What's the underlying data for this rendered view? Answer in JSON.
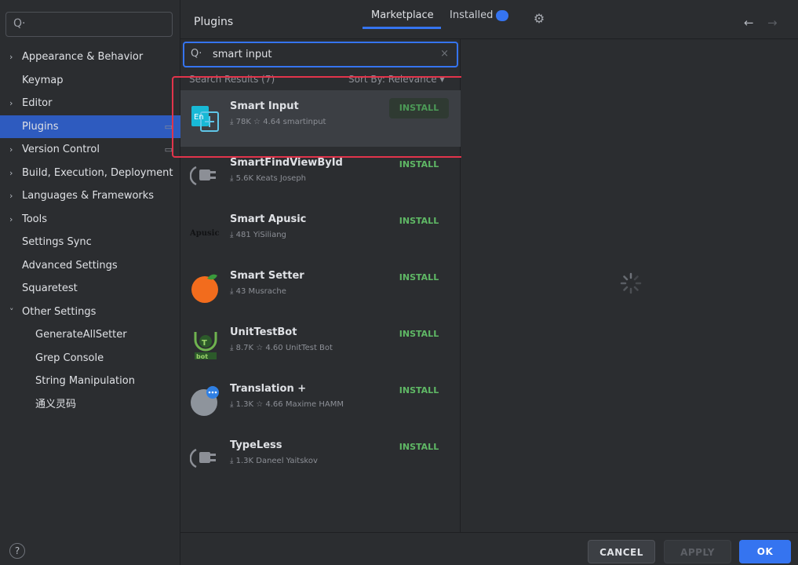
{
  "sidebar": {
    "search_glyph": "Q·",
    "items": [
      {
        "label": "Appearance & Behavior",
        "chevron": "›"
      },
      {
        "label": "Keymap"
      },
      {
        "label": "Editor",
        "chevron": "›"
      },
      {
        "label": "Plugins"
      },
      {
        "label": "Version Control",
        "chevron": "›"
      },
      {
        "label": "Build, Execution, Deployment",
        "chevron": "›"
      },
      {
        "label": "Languages & Frameworks",
        "chevron": "›"
      },
      {
        "label": "Tools",
        "chevron": "›"
      },
      {
        "label": "Settings Sync"
      },
      {
        "label": "Advanced Settings"
      },
      {
        "label": "Squaretest"
      },
      {
        "label": "Other Settings",
        "chevron": "˅"
      },
      {
        "label": "GenerateAllSetter"
      },
      {
        "label": "Grep Console"
      },
      {
        "label": "String Manipulation"
      },
      {
        "label": "通义灵码"
      }
    ],
    "help": "?"
  },
  "header": {
    "title": "Plugins",
    "tabs": {
      "marketplace": "Marketplace",
      "installed": "Installed"
    },
    "back": "←",
    "forward": "→",
    "gear": "⚙"
  },
  "search": {
    "glyph": "Q·",
    "value": "smart input",
    "clear": "×",
    "results_label": "Search Results (7)",
    "sort_label": "Sort By: Relevance ▾"
  },
  "plugins": [
    {
      "name": "Smart Input",
      "meta": "⤓ 78K  ☆ 4.64  smartinput",
      "install": "INSTALL"
    },
    {
      "name": "SmartFindViewById",
      "meta": "⤓ 5.6K  Keats Joseph",
      "install": "INSTALL"
    },
    {
      "name": "Smart Apusic",
      "meta": "⤓ 481  YiSiliang",
      "install": "INSTALL",
      "logo_text": "Apusic"
    },
    {
      "name": "Smart Setter",
      "meta": "⤓ 43  Musrache",
      "install": "INSTALL"
    },
    {
      "name": "UnitTestBot",
      "meta": "⤓ 8.7K  ☆ 4.60  UnitTest Bot",
      "install": "INSTALL"
    },
    {
      "name": "Translation +",
      "meta": "⤓ 1.3K  ☆ 4.66  Maxime HAMM",
      "install": "INSTALL"
    },
    {
      "name": "TypeLess",
      "meta": "⤓ 1.3K  Daneel Yaitskov",
      "install": "INSTALL"
    }
  ],
  "footer": {
    "cancel": "CANCEL",
    "apply": "APPLY",
    "ok": "OK"
  },
  "colors": {
    "accent": "#3574f0",
    "install_green": "#5fb865",
    "highlight_red": "#e2344b"
  }
}
